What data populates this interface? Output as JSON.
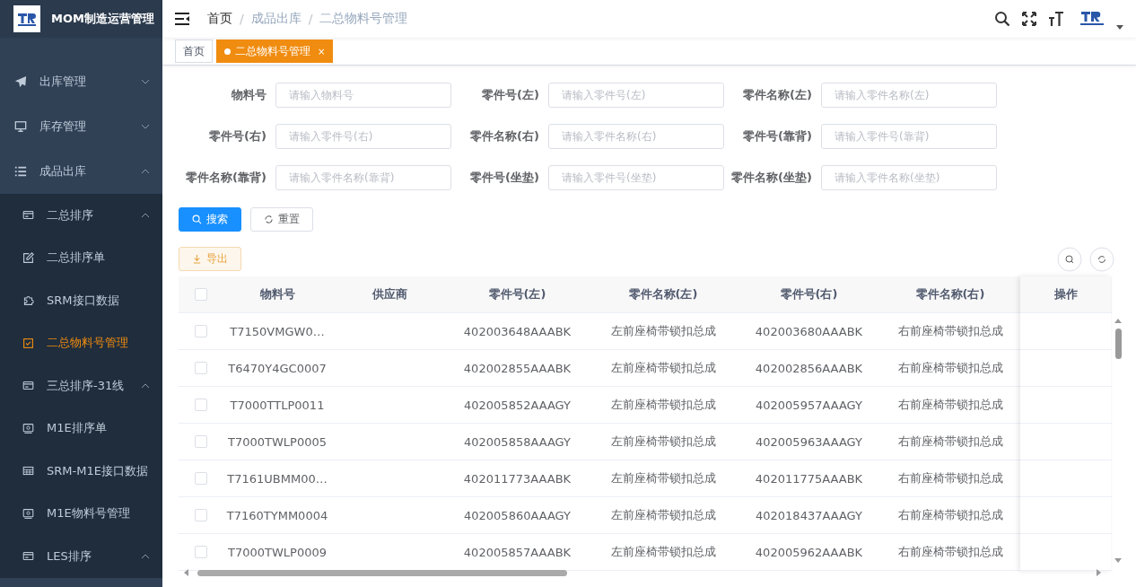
{
  "app": {
    "title": "MOM制造运营管理"
  },
  "sidebar": {
    "items": [
      {
        "label": "出库管理",
        "kind": "group",
        "expanded": false,
        "selected": false
      },
      {
        "label": "库存管理",
        "kind": "group",
        "expanded": false,
        "selected": false
      },
      {
        "label": "成品出库",
        "kind": "group",
        "expanded": true,
        "selected": false,
        "children": [
          {
            "label": "二总排序",
            "kind": "group",
            "expanded": true,
            "selected": false
          },
          {
            "label": "二总排序单",
            "kind": "item",
            "selected": false
          },
          {
            "label": "SRM接口数据",
            "kind": "item",
            "selected": false
          },
          {
            "label": "二总物料号管理",
            "kind": "item",
            "selected": true
          },
          {
            "label": "三总排序-31线",
            "kind": "group",
            "expanded": true,
            "selected": false
          },
          {
            "label": "M1E排序单",
            "kind": "item",
            "selected": false
          },
          {
            "label": "SRM-M1E接口数据",
            "kind": "item",
            "selected": false
          },
          {
            "label": "M1E物料号管理",
            "kind": "item",
            "selected": false
          },
          {
            "label": "LES排序",
            "kind": "group",
            "expanded": true,
            "selected": false
          }
        ]
      }
    ]
  },
  "breadcrumb": {
    "separator": "/",
    "items": [
      "首页",
      "成品出库",
      "二总物料号管理"
    ]
  },
  "tags": [
    {
      "label": "首页",
      "selected": false,
      "closable": false
    },
    {
      "label": "二总物料号管理",
      "selected": true,
      "closable": true,
      "close": "×"
    }
  ],
  "filters": [
    {
      "label": "物料号",
      "placeholder": "请输入物料号"
    },
    {
      "label": "零件号(左)",
      "placeholder": "请输入零件号(左)"
    },
    {
      "label": "零件名称(左)",
      "placeholder": "请输入零件名称(左)"
    },
    {
      "label": "零件号(右)",
      "placeholder": "请输入零件号(右)"
    },
    {
      "label": "零件名称(右)",
      "placeholder": "请输入零件名称(右)"
    },
    {
      "label": "零件号(靠背)",
      "placeholder": "请输入零件号(靠背)"
    },
    {
      "label": "零件名称(靠背)",
      "placeholder": "请输入零件名称(靠背)"
    },
    {
      "label": "零件号(坐垫)",
      "placeholder": "请输入零件号(坐垫)"
    },
    {
      "label": "零件名称(坐垫)",
      "placeholder": "请输入零件名称(坐垫)"
    }
  ],
  "buttons": {
    "search": "搜索",
    "reset": "重置",
    "export": "导出"
  },
  "table": {
    "select_all_checked": false,
    "columns": [
      "物料号",
      "供应商",
      "零件号(左)",
      "零件名称(左)",
      "零件号(右)",
      "零件名称(右)",
      "操作"
    ],
    "rows": [
      {
        "checked": false,
        "cells": [
          "T7150VMGW0…",
          "",
          "402003648AAABK",
          "左前座椅带锁扣总成",
          "402003680AAABK",
          "右前座椅带锁扣总成"
        ]
      },
      {
        "checked": false,
        "cells": [
          "T6470Y4GC0007",
          "",
          "402002855AAABK",
          "左前座椅带锁扣总成",
          "402002856AAABK",
          "右前座椅带锁扣总成"
        ]
      },
      {
        "checked": false,
        "cells": [
          "T7000TTLP0011",
          "",
          "402005852AAAGY",
          "左前座椅带锁扣总成",
          "402005957AAAGY",
          "右前座椅带锁扣总成"
        ]
      },
      {
        "checked": false,
        "cells": [
          "T7000TWLP0005",
          "",
          "402005858AAAGY",
          "左前座椅带锁扣总成",
          "402005963AAAGY",
          "右前座椅带锁扣总成"
        ]
      },
      {
        "checked": false,
        "cells": [
          "T7161UBMM00…",
          "",
          "402011773AAABK",
          "左前座椅带锁扣总成",
          "402011775AAABK",
          "右前座椅带锁扣总成"
        ]
      },
      {
        "checked": false,
        "cells": [
          "T7160TYMM0004",
          "",
          "402005860AAAGY",
          "左前座椅带锁扣总成",
          "402018437AAAGY",
          "右前座椅带锁扣总成"
        ]
      },
      {
        "checked": false,
        "cells": [
          "T7000TWLP0009",
          "",
          "402005857AAABK",
          "左前座椅带锁扣总成",
          "402005962AAABK",
          "右前座椅带锁扣总成"
        ]
      }
    ]
  }
}
